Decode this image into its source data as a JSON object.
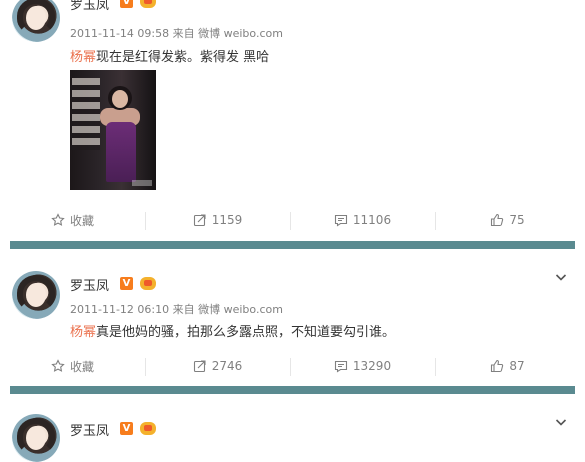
{
  "posts": [
    {
      "name": "罗玉凤",
      "time": "2011-11-14 09:58 来自 微博 weibo.com",
      "mention": "杨幂",
      "text": "现在是红得发紫。紫得发 黑哈",
      "actions": {
        "favorite": "收藏",
        "repost": "1159",
        "comment": "11106",
        "like": "75"
      }
    },
    {
      "name": "罗玉凤",
      "time": "2011-11-12 06:10 来自 微博 weibo.com",
      "mention": "杨幂",
      "text": "真是他妈的骚，拍那么多露点照，不知道要勾引谁。",
      "actions": {
        "favorite": "收藏",
        "repost": "2746",
        "comment": "13290",
        "like": "87"
      }
    },
    {
      "name": "罗玉凤"
    }
  ],
  "icons": {
    "favorite": "star-icon",
    "repost": "repost-icon",
    "comment": "comment-icon",
    "like": "thumbs-up-icon",
    "menu": "chevron-down-icon"
  },
  "colors": {
    "divider": "#5a8a90",
    "mention": "#eb7350",
    "meta": "#808080"
  }
}
